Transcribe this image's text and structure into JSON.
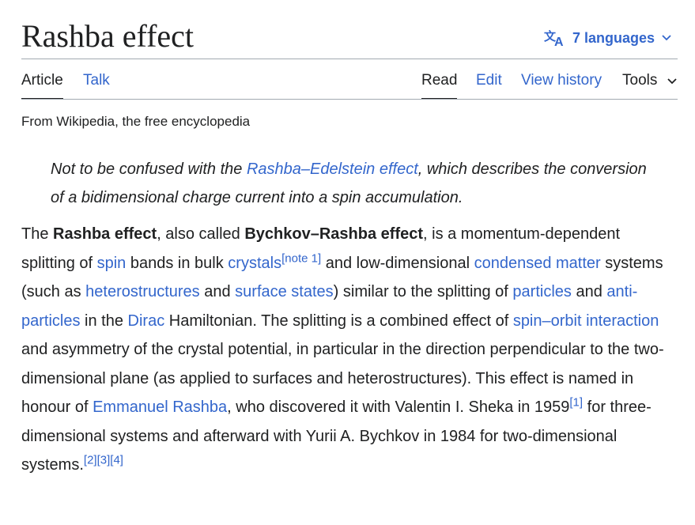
{
  "page": {
    "title": "Rashba effect",
    "languages_label": "7 languages",
    "tagline": "From Wikipedia, the free encyclopedia"
  },
  "tabs": {
    "article": "Article",
    "talk": "Talk",
    "read": "Read",
    "edit": "Edit",
    "history": "View history",
    "tools": "Tools"
  },
  "hatnote": {
    "pre": "Not to be confused with the ",
    "link": "Rashba–Edelstein effect",
    "post": ", which describes the conversion of a bidimensional charge current into a spin accumulation."
  },
  "body": {
    "t1": "The ",
    "b1": "Rashba effect",
    "t2": ", also called ",
    "b2": "Bychkov–Rashba effect",
    "t3": ", is a momentum-dependent splitting of ",
    "l_spin": "spin",
    "t4": " bands in bulk ",
    "l_crystals": "crystals",
    "ref_note1": "[note 1]",
    "t5": " and low-dimensional ",
    "l_condensed": "condensed matter",
    "t6": " systems (such as ",
    "l_hetero": "heterostructures",
    "t7": " and ",
    "l_surface": "surface states",
    "t8": ") similar to the splitting of ",
    "l_particles": "particles",
    "t9": " and ",
    "l_anti": "anti-particles",
    "t10": " in the ",
    "l_dirac": "Dirac",
    "t11": " Hamiltonian. The splitting is a combined effect of ",
    "l_soi": "spin–orbit interaction",
    "t12": " and asymmetry of the crystal potential, in particular in the direction perpendicular to the two-dimensional plane (as applied to surfaces and heterostructures). This effect is named in honour of ",
    "l_rashba": "Emmanuel Rashba",
    "t13": ", who discovered it with Valentin I. Sheka in 1959",
    "ref1": "[1]",
    "t14": " for three-dimensional systems and afterward with Yurii A. Bychkov in 1984 for two-dimensional systems.",
    "ref2": "[2]",
    "ref3": "[3]",
    "ref4": "[4]"
  }
}
